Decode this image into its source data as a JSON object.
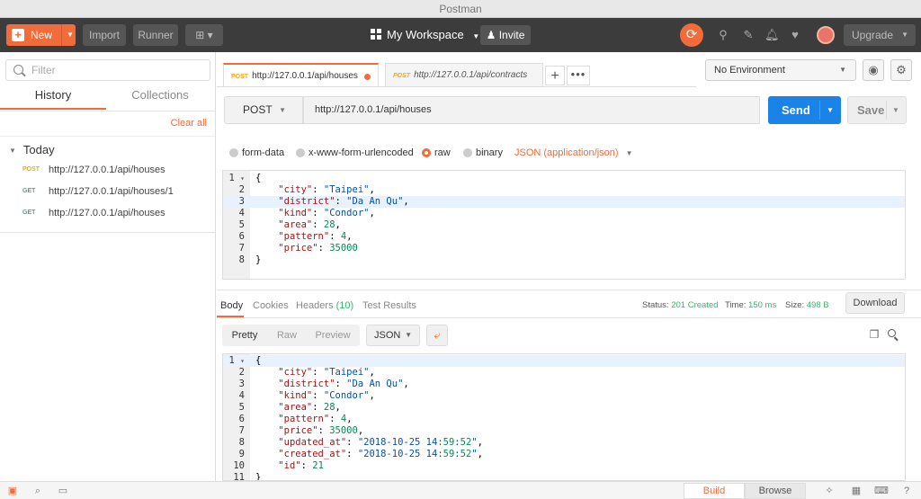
{
  "window": {
    "title": "Postman"
  },
  "toolbar": {
    "new_label": "New",
    "import_label": "Import",
    "runner_label": "Runner",
    "workspace_label": "My Workspace",
    "invite_label": "Invite",
    "upgrade_label": "Upgrade"
  },
  "sidebar": {
    "filter_placeholder": "Filter",
    "tabs": [
      "History",
      "Collections"
    ],
    "clear_all": "Clear all",
    "group_label": "Today",
    "items": [
      {
        "method": "POST",
        "url": "http://127.0.0.1/api/houses"
      },
      {
        "method": "GET",
        "url": "http://127.0.0.1/api/houses/1"
      },
      {
        "method": "GET",
        "url": "http://127.0.0.1/api/houses"
      }
    ]
  },
  "tabs": [
    {
      "method": "POST",
      "url": "http://127.0.0.1/api/houses"
    },
    {
      "method": "POST",
      "url": "http://127.0.0.1/api/contracts"
    }
  ],
  "environment": {
    "selected": "No Environment"
  },
  "request": {
    "method": "POST",
    "url": "http://127.0.0.1/api/houses",
    "send_label": "Send",
    "save_label": "Save",
    "body_options": [
      "form-data",
      "x-www-form-urlencoded",
      "raw",
      "binary"
    ],
    "selected_body_option": "raw",
    "content_type": "JSON (application/json)",
    "body_lines": [
      "{",
      "    \"city\": \"Taipei\",",
      "    \"district\": \"Da An Qu\",",
      "    \"kind\": \"Condor\",",
      "    \"area\": 28,",
      "    \"pattern\": 4,",
      "    \"price\": 35000",
      "}"
    ]
  },
  "response": {
    "tabs": [
      "Body",
      "Cookies",
      "Headers",
      "Test Results"
    ],
    "headers_count": "(10)",
    "status_label": "Status:",
    "status_value": "201 Created",
    "time_label": "Time:",
    "time_value": "150 ms",
    "size_label": "Size:",
    "size_value": "498 B",
    "download_label": "Download",
    "view_modes": [
      "Pretty",
      "Raw",
      "Preview"
    ],
    "format": "JSON",
    "body_lines": [
      "{",
      "    \"city\": \"Taipei\",",
      "    \"district\": \"Da An Qu\",",
      "    \"kind\": \"Condor\",",
      "    \"area\": 28,",
      "    \"pattern\": 4,",
      "    \"price\": 35000,",
      "    \"updated_at\": \"2018-10-25 14:59:52\",",
      "    \"created_at\": \"2018-10-25 14:59:52\",",
      "    \"id\": 21",
      "}"
    ]
  },
  "statusbar": {
    "build_label": "Build",
    "browse_label": "Browse"
  },
  "colors": {
    "accent": "#f26b3a",
    "send": "#1a83e8",
    "success": "#3cb371"
  }
}
